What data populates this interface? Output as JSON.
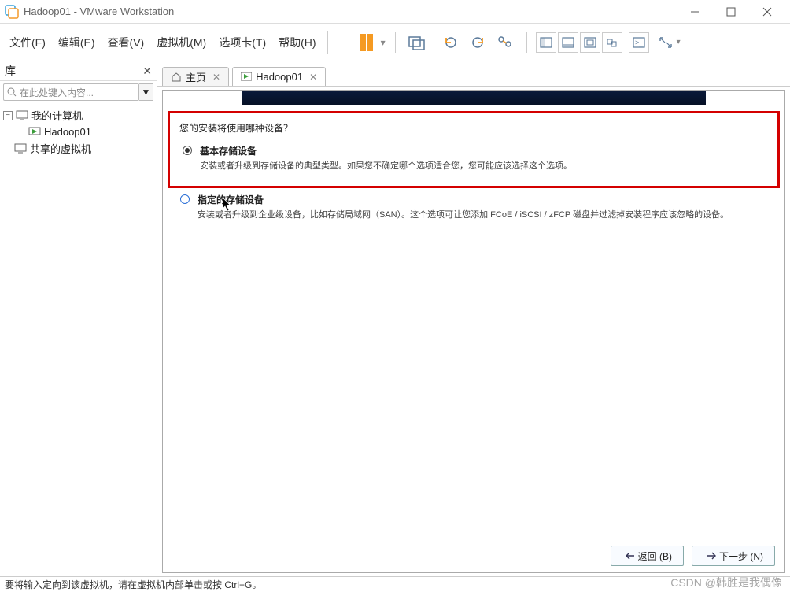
{
  "window": {
    "title": "Hadoop01 - VMware Workstation"
  },
  "menu": {
    "file": "文件(F)",
    "edit": "编辑(E)",
    "view": "查看(V)",
    "vm": "虚拟机(M)",
    "tabs": "选项卡(T)",
    "help": "帮助(H)"
  },
  "sidebar": {
    "header": "库",
    "search_placeholder": "在此处键入内容...",
    "tree": {
      "root": "我的计算机",
      "child": "Hadoop01",
      "shared": "共享的虚拟机"
    }
  },
  "tabs": {
    "home": "主页",
    "vm": "Hadoop01"
  },
  "installer": {
    "question": "您的安装将使用哪种设备？",
    "opt1_title": "基本存储设备",
    "opt1_desc": "安装或者升级到存储设备的典型类型。如果您不确定哪个选项适合您，您可能应该选择这个选项。",
    "opt2_title": "指定的存储设备",
    "opt2_desc": "安装或者升级到企业级设备，比如存储局域网（SAN）。这个选项可让您添加 FCoE / iSCSI / zFCP 磁盘并过滤掉安装程序应该忽略的设备。"
  },
  "nav": {
    "back": "返回 (B)",
    "next": "下一步 (N)"
  },
  "status": {
    "hint": "要将输入定向到该虚拟机，请在虚拟机内部单击或按 Ctrl+G。"
  },
  "watermark": "CSDN @韩胜是我偶像"
}
